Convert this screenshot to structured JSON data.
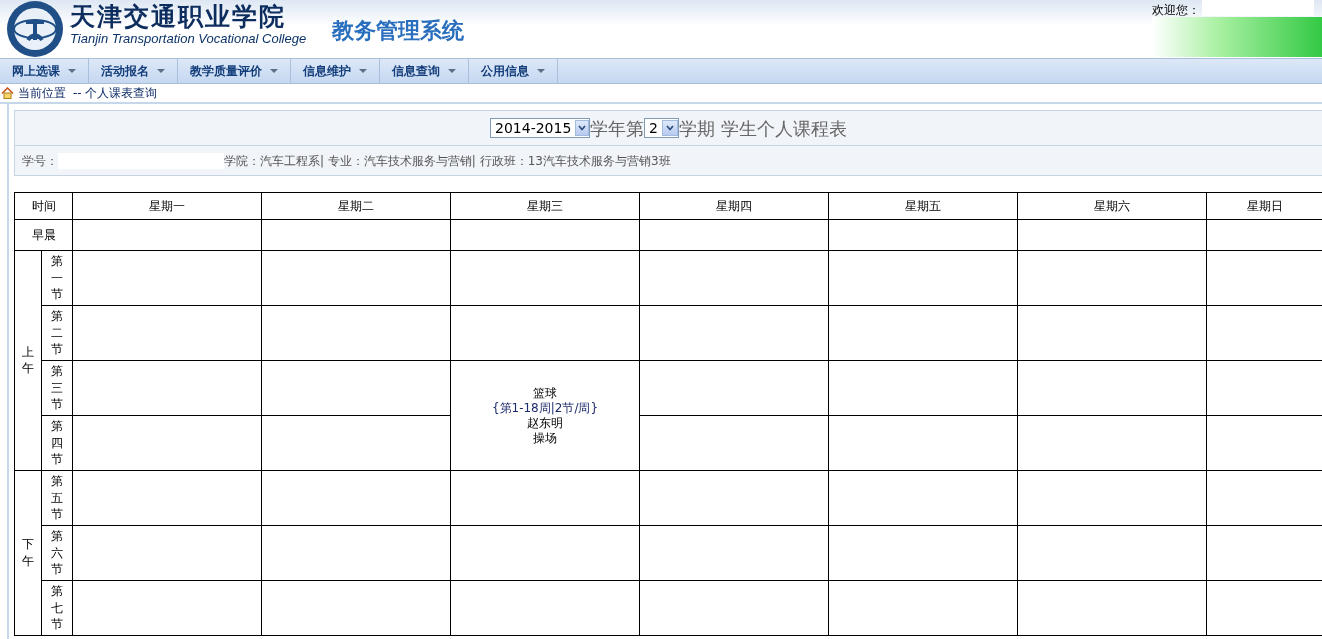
{
  "header": {
    "school_name_cn": "天津交通职业学院",
    "school_name_en": "Tianjin Transportation Vocational College",
    "system_title": "教务管理系统",
    "welcome": "欢迎您："
  },
  "menu": [
    {
      "label": "网上选课"
    },
    {
      "label": "活动报名"
    },
    {
      "label": "教学质量评价"
    },
    {
      "label": "信息维护"
    },
    {
      "label": "信息查询"
    },
    {
      "label": "公用信息"
    }
  ],
  "breadcrumb": {
    "label": "当前位置",
    "path": "-- 个人课表查询"
  },
  "term": {
    "year": "2014-2015",
    "year_suffix": "学年第",
    "semester": "2",
    "semester_suffix": "学期",
    "title": "学生个人课程表"
  },
  "student_info": {
    "id_label": "学号：",
    "details": "学院：汽车工程系| 专业：汽车技术服务与营销| 行政班：13汽车技术服务与营销3班"
  },
  "timetable": {
    "time_heading": "时间",
    "days": [
      "星期一",
      "星期二",
      "星期三",
      "星期四",
      "星期五",
      "星期六",
      "星期日"
    ],
    "morning_label": "早晨",
    "groups": [
      {
        "label": "上午",
        "periods": [
          {
            "label": "第一节",
            "cells": [
              {
                "continued": false
              },
              {
                "continued": false
              },
              {
                "continued": false
              },
              {
                "continued": false
              },
              {
                "continued": false
              },
              {
                "continued": false
              },
              {
                "continued": false
              }
            ]
          },
          {
            "label": "第二节",
            "cells": [
              {
                "continued": false
              },
              {
                "continued": false
              },
              {
                "continued": false
              },
              {
                "continued": false
              },
              {
                "continued": false
              },
              {
                "continued": false
              },
              {
                "continued": false
              }
            ]
          },
          {
            "label": "第三节",
            "cells": [
              {
                "continued": false
              },
              {
                "continued": false
              },
              {
                "continued": false,
                "course": {
                  "name": "篮球",
                  "weeks": "{第1-18周|2节/周}",
                  "teacher": "赵东明",
                  "place": "操场"
                }
              },
              {
                "continued": false
              },
              {
                "continued": false
              },
              {
                "continued": false
              },
              {
                "continued": false
              }
            ]
          },
          {
            "label": "第四节",
            "cells": [
              {
                "continued": false
              },
              {
                "continued": false
              },
              {
                "continued": true
              },
              {
                "continued": false
              },
              {
                "continued": false
              },
              {
                "continued": false
              },
              {
                "continued": false
              }
            ]
          }
        ]
      },
      {
        "label": "下午",
        "periods": [
          {
            "label": "第五节",
            "cells": [
              {
                "continued": false
              },
              {
                "continued": false
              },
              {
                "continued": false
              },
              {
                "continued": false
              },
              {
                "continued": false
              },
              {
                "continued": false
              },
              {
                "continued": false
              }
            ]
          },
          {
            "label": "第六节",
            "cells": [
              {
                "continued": false
              },
              {
                "continued": false
              },
              {
                "continued": false
              },
              {
                "continued": false
              },
              {
                "continued": false
              },
              {
                "continued": false
              },
              {
                "continued": false
              }
            ]
          },
          {
            "label": "第七节",
            "cells": [
              {
                "continued": false
              },
              {
                "continued": false
              },
              {
                "continued": false
              },
              {
                "continued": false
              },
              {
                "continued": false
              },
              {
                "continued": false
              },
              {
                "continued": false
              }
            ]
          }
        ]
      }
    ]
  }
}
